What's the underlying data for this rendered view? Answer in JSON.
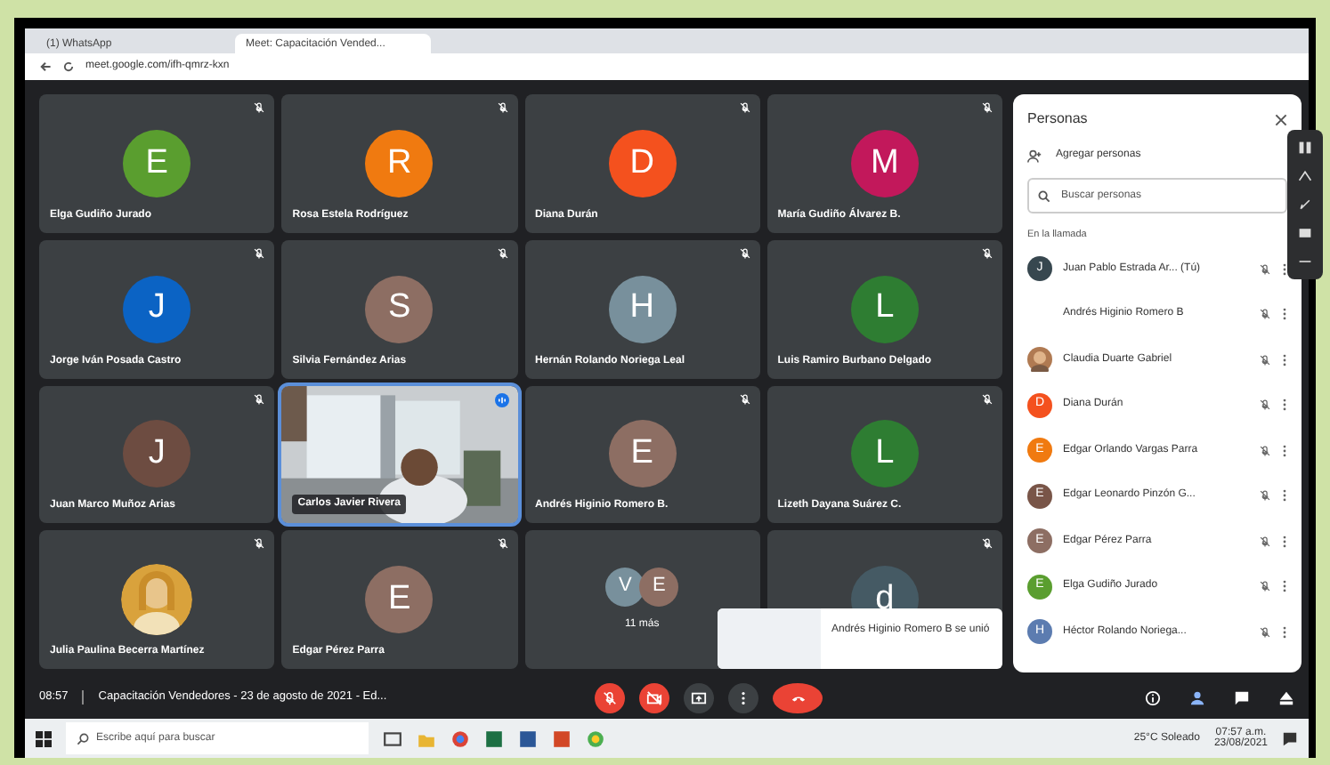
{
  "browser": {
    "tabs": [
      {
        "title": "(1) WhatsApp",
        "selected": false
      },
      {
        "title": "Meet: Capacitación Vended...",
        "selected": true
      }
    ],
    "url": "meet.google.com/ifh-qmrz-kxn"
  },
  "tiles": [
    {
      "kind": "avatar",
      "name": "Elga Gudiño Jurado",
      "initial": "E",
      "color": "#5a9e2f",
      "muted": true
    },
    {
      "kind": "avatar",
      "name": "Rosa Estela Rodríguez",
      "initial": "R",
      "color": "#f07a10",
      "muted": true
    },
    {
      "kind": "avatar",
      "name": "Diana Durán",
      "initial": "D",
      "color": "#f4511e",
      "muted": true
    },
    {
      "kind": "avatar",
      "name": "María Gudiño Álvarez B.",
      "initial": "M",
      "color": "#c2185b",
      "muted": true
    },
    {
      "kind": "avatar",
      "name": "Jorge Iván Posada Castro",
      "initial": "J",
      "color": "#0b63c4",
      "muted": true
    },
    {
      "kind": "avatar",
      "name": "Silvia Fernández Arias",
      "initial": "S",
      "color": "#8d6e63",
      "muted": true
    },
    {
      "kind": "avatar",
      "name": "Hernán Rolando Noriega Leal",
      "initial": "H",
      "color": "#78909c",
      "muted": true
    },
    {
      "kind": "avatar",
      "name": "Luis Ramiro Burbano Delgado",
      "initial": "L",
      "color": "#2e7d32",
      "muted": true
    },
    {
      "kind": "avatar",
      "name": "Juan Marco Muñoz Arias",
      "initial": "J",
      "color": "#6d4c41",
      "muted": true
    },
    {
      "kind": "video",
      "name": "Carlos Javier Rivera",
      "muted": false
    },
    {
      "kind": "avatar",
      "name": "Andrés Higinio Romero B.",
      "initial": "E",
      "color": "#8d6e63",
      "muted": true
    },
    {
      "kind": "avatar",
      "name": "Lizeth Dayana Suárez C.",
      "initial": "L",
      "color": "#2e7d32",
      "muted": true
    },
    {
      "name": "Julia Paulina Becerra Martínez",
      "muted": true
    },
    {
      "kind": "avatar",
      "name": "Edgar Pérez Parra",
      "initial": "E",
      "color": "#8d6e63",
      "muted": true
    },
    {
      "kind": "group",
      "name": "11 más",
      "avatars": [
        {
          "initial": "V",
          "color": "#78909c"
        },
        {
          "initial": "E",
          "color": "#8d6e63"
        }
      ],
      "muted": false
    },
    {
      "kind": "avatar",
      "initial": "d",
      "color": "#455a64",
      "muted": true
    }
  ],
  "toast": {
    "text": "Andrés Higinio Romero B se unió"
  },
  "meeting": {
    "time": "08:57",
    "title": "Capacitación Vendedores - 23 de agosto de 2021 - Ed..."
  },
  "panel": {
    "title": "Personas",
    "add": "Agregar personas",
    "search_placeholder": "Buscar personas",
    "section": "En la llamada",
    "people": [
      {
        "kind": "initial",
        "name": "Juan Pablo Estrada Ar... (Tú)",
        "initial": "J",
        "color": "#37474f"
      },
      {
        "kind": "none",
        "name": "Andrés Higinio Romero B"
      },
      {
        "name": "Claudia Duarte Gabriel"
      },
      {
        "kind": "initial",
        "name": "Diana Durán",
        "initial": "D",
        "color": "#f4511e"
      },
      {
        "kind": "initial",
        "name": "Edgar Orlando Vargas Parra",
        "initial": "E",
        "color": "#f07a10"
      },
      {
        "kind": "initial",
        "name": "Edgar Leonardo Pinzón G...",
        "initial": "E",
        "color": "#795548"
      },
      {
        "kind": "initial",
        "name": "Edgar Pérez Parra",
        "initial": "E",
        "color": "#8d6e63"
      },
      {
        "kind": "initial",
        "name": "Elga Gudiño Jurado",
        "initial": "E",
        "color": "#5a9e2f"
      },
      {
        "kind": "initial",
        "name": "Héctor Rolando Noriega...",
        "initial": "H",
        "color": "#5c7cb0"
      }
    ]
  },
  "taskbar": {
    "search_placeholder": "Escribe aquí para buscar",
    "weather": "25°C Soleado",
    "clock": "07:57 a.m.",
    "date": "23/08/2021"
  }
}
